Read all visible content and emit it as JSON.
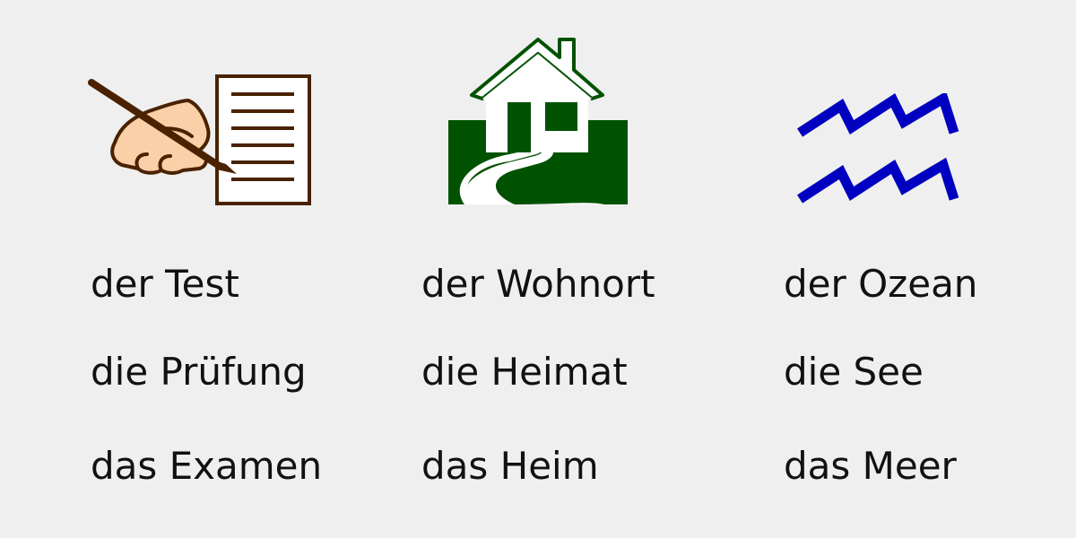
{
  "icons": {
    "writing": "writing-hand-icon",
    "home": "house-icon",
    "water": "water-waves-icon"
  },
  "colors": {
    "background": "#efefef",
    "text": "#111111",
    "writing_stroke": "#4a2200",
    "skin": "#f9d0a8",
    "paper": "#ffffff",
    "house_green": "#005200",
    "water_blue": "#0000c0"
  },
  "columns": [
    {
      "words": [
        "der Test",
        "die Prüfung",
        "das Examen"
      ]
    },
    {
      "words": [
        "der Wohnort",
        "die Heimat",
        "das Heim"
      ]
    },
    {
      "words": [
        "der Ozean",
        "die See",
        "das Meer"
      ]
    }
  ]
}
